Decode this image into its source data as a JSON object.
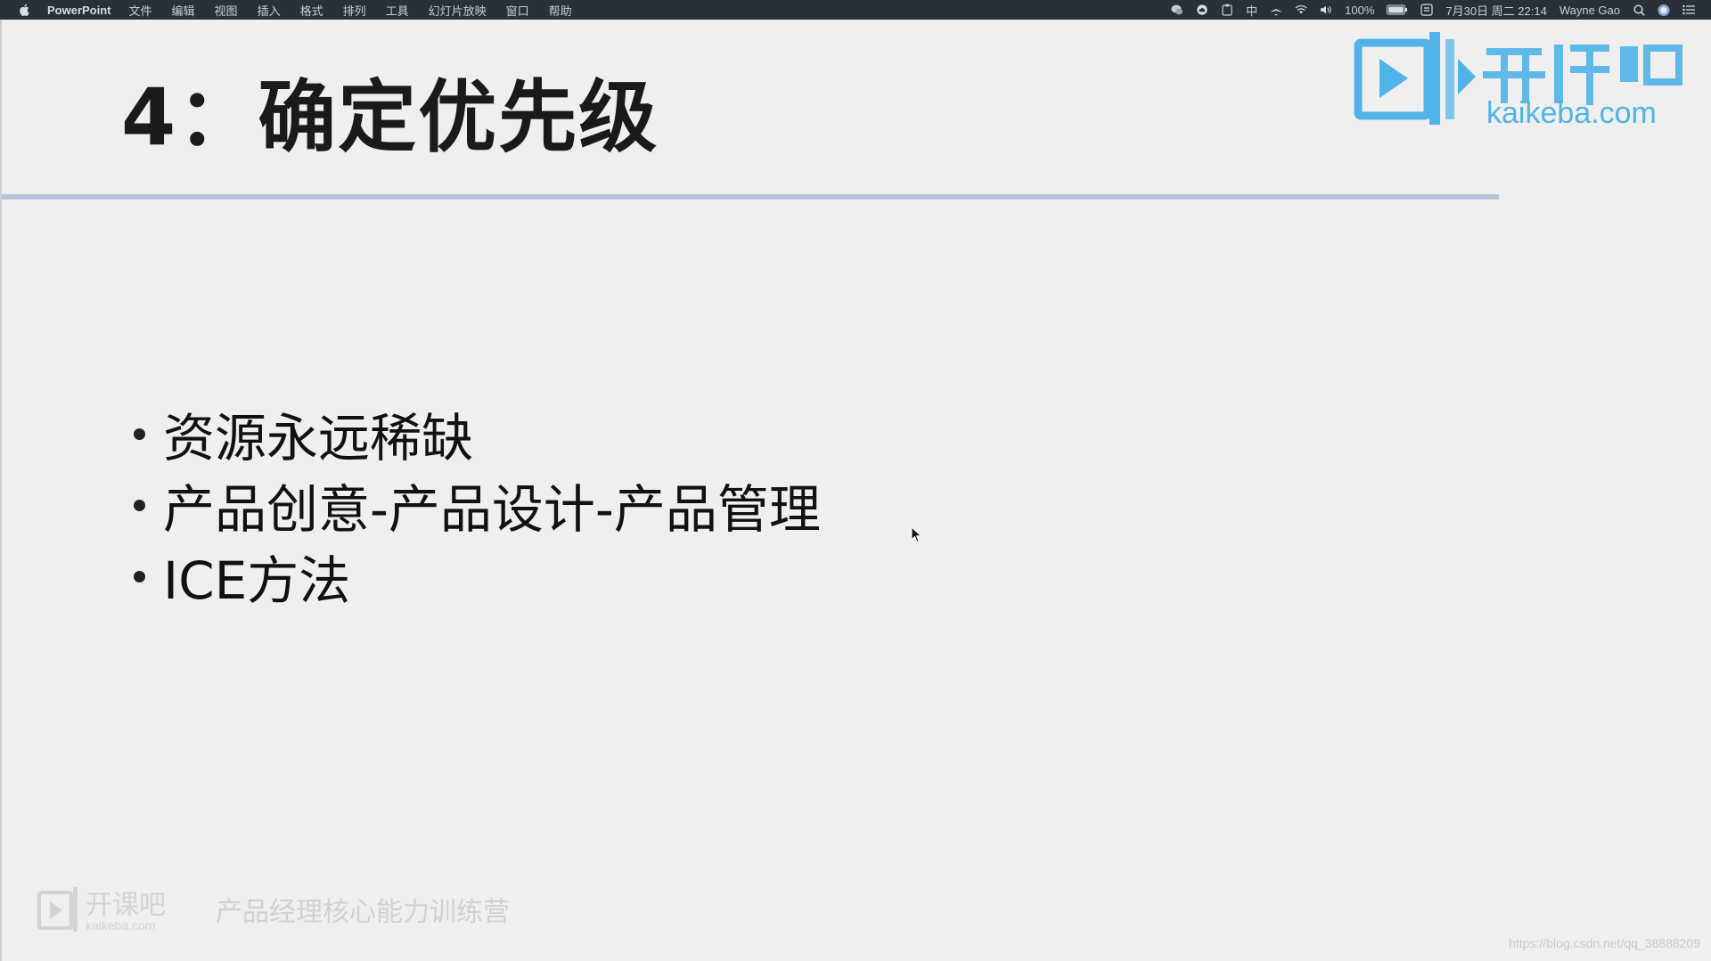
{
  "menubar": {
    "app_name": "PowerPoint",
    "items": [
      "文件",
      "编辑",
      "视图",
      "插入",
      "格式",
      "排列",
      "工具",
      "幻灯片放映",
      "窗口",
      "帮助"
    ],
    "battery": "100%",
    "input_method": "中",
    "datetime": "7月30日 周二 22:14",
    "user": "Wayne Gao"
  },
  "slide": {
    "title": "4：确定优先级",
    "bullets": [
      "资源永远稀缺",
      "产品创意-产品设计-产品管理",
      "ICE方法"
    ],
    "footer_tagline": "产品经理核心能力训练营",
    "logo_text": "开课吧",
    "logo_domain": "kaikeba.com"
  },
  "watermark": "https://blog.csdn.net/qq_38888209",
  "colors": {
    "menubar_bg": "#2a3038",
    "slide_bg": "#efefef",
    "title_rule": "#b6c4db",
    "logo_blue": "#4fb3e8"
  }
}
